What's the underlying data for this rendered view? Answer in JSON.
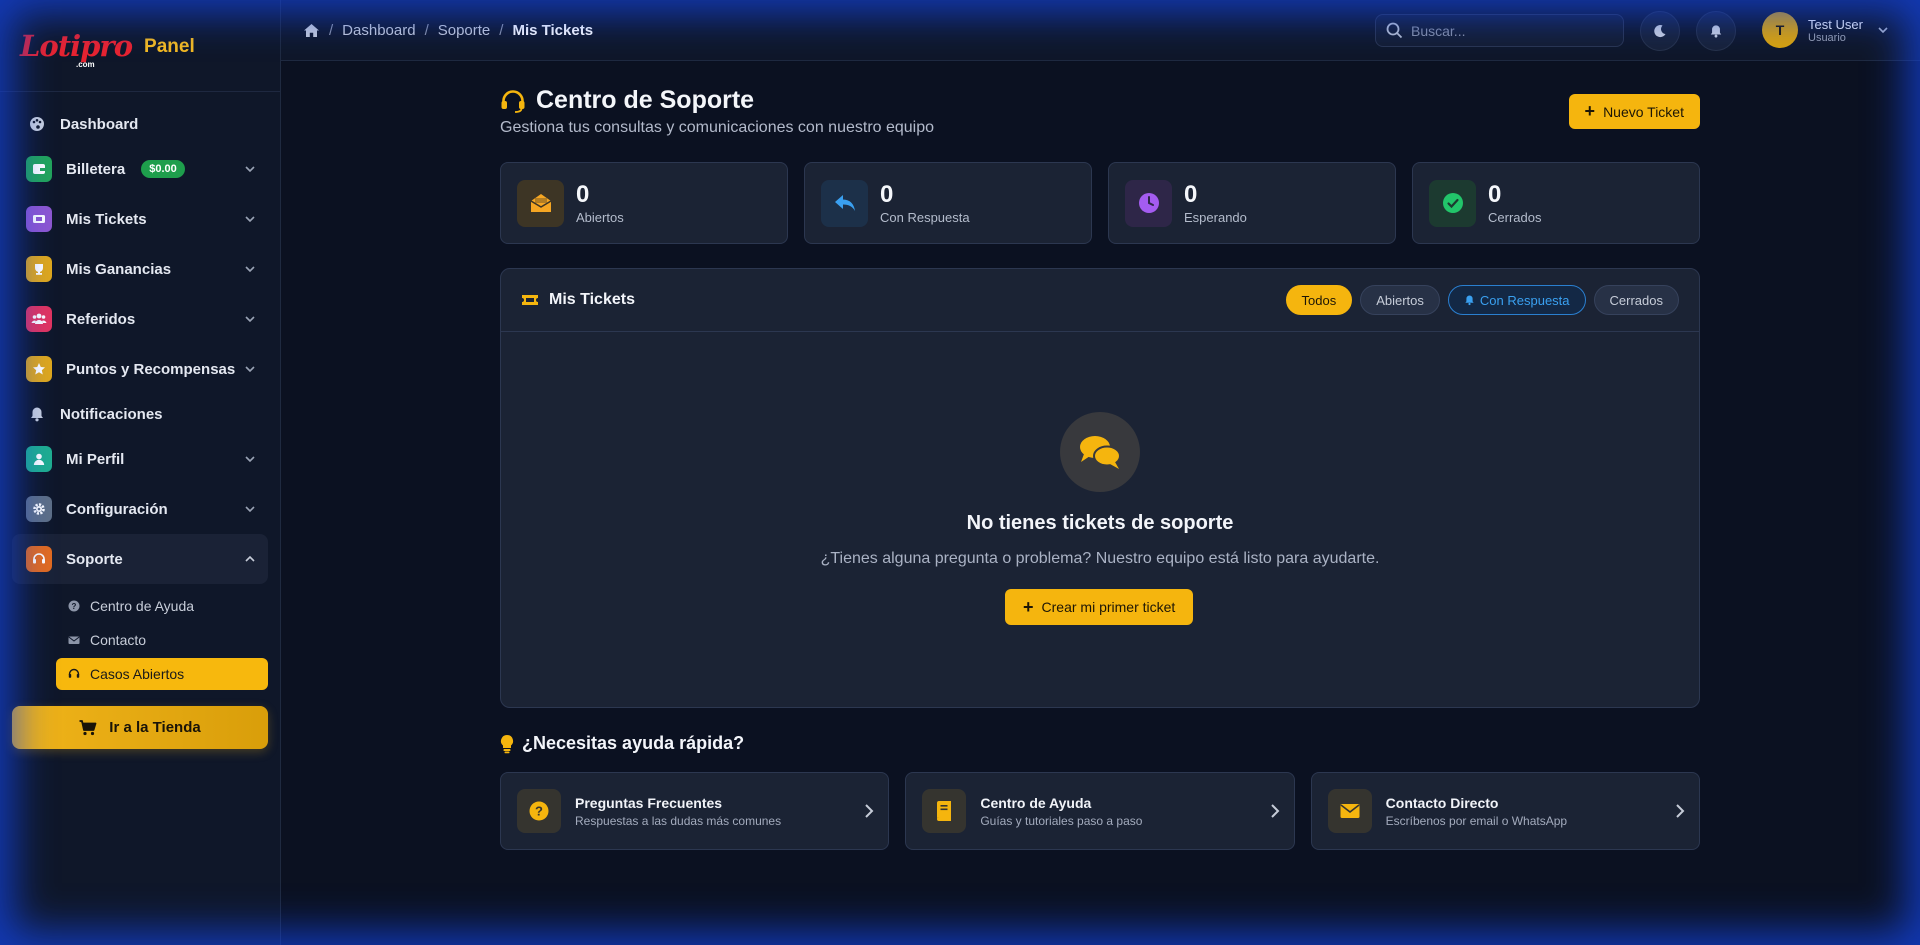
{
  "brand": {
    "logo_text": "Lotipro",
    "logo_suffix": ".com",
    "panel_label": "Panel"
  },
  "sidebar": {
    "items": [
      {
        "label": "Dashboard",
        "icon": "palette-icon"
      },
      {
        "label": "Billetera",
        "icon": "wallet-icon",
        "badge": "$0.00",
        "color": "#22a55a"
      },
      {
        "label": "Mis Tickets",
        "icon": "ticket-icon",
        "color": "#8e57d1"
      },
      {
        "label": "Mis Ganancias",
        "icon": "trophy-icon",
        "color": "#e0a81b"
      },
      {
        "label": "Referidos",
        "icon": "users-icon",
        "color": "#e3345f"
      },
      {
        "label": "Puntos y Recompensas",
        "icon": "star-icon",
        "color": "#e0a81b"
      },
      {
        "label": "Notificaciones",
        "icon": "bell-icon"
      },
      {
        "label": "Mi Perfil",
        "icon": "user-icon",
        "color": "#1fae8f"
      },
      {
        "label": "Configuración",
        "icon": "gear-icon",
        "color": "#5e6f86"
      },
      {
        "label": "Soporte",
        "icon": "headset-icon",
        "color": "#e46b1e"
      }
    ],
    "support_sub": [
      {
        "label": "Centro de Ayuda",
        "icon": "question-circle-icon"
      },
      {
        "label": "Contacto",
        "icon": "envelope-icon"
      },
      {
        "label": "Casos Abiertos",
        "icon": "headset-icon"
      }
    ],
    "shop_button": "Ir a la Tienda"
  },
  "topbar": {
    "breadcrumb": [
      "Dashboard",
      "Soporte",
      "Mis Tickets"
    ],
    "search_placeholder": "Buscar...",
    "user_name": "Test User",
    "user_role": "Usuario",
    "avatar_initial": "T"
  },
  "page": {
    "title": "Centro de Soporte",
    "subtitle": "Gestiona tus consultas y comunicaciones con nuestro equipo",
    "new_ticket": "Nuevo Ticket"
  },
  "stats": [
    {
      "value": "0",
      "label": "Abiertos",
      "icon": "envelope-open-icon",
      "color": "#f5a623"
    },
    {
      "value": "0",
      "label": "Con Respuesta",
      "icon": "reply-icon",
      "color": "#3aa0f0"
    },
    {
      "value": "0",
      "label": "Esperando",
      "icon": "clock-icon",
      "color": "#a45cf0"
    },
    {
      "value": "0",
      "label": "Cerrados",
      "icon": "check-circle-icon",
      "color": "#22c56a"
    }
  ],
  "tickets_panel": {
    "title": "Mis Tickets",
    "filters": [
      "Todos",
      "Abiertos",
      "Con Respuesta",
      "Cerrados"
    ],
    "active_filter": "Todos",
    "empty_title": "No tienes tickets de soporte",
    "empty_sub": "¿Tienes alguna pregunta o problema? Nuestro equipo está listo para ayudarte.",
    "create_first": "Crear mi primer ticket"
  },
  "quick_help": {
    "title": "¿Necesitas ayuda rápida?",
    "cards": [
      {
        "title": "Preguntas Frecuentes",
        "sub": "Respuestas a las dudas más comunes",
        "icon": "question-circle-icon"
      },
      {
        "title": "Centro de Ayuda",
        "sub": "Guías y tutoriales paso a paso",
        "icon": "book-icon"
      },
      {
        "title": "Contacto Directo",
        "sub": "Escríbenos por email o WhatsApp",
        "icon": "envelope-icon"
      }
    ]
  },
  "colors": {
    "accent": "#f5b50e",
    "background": "#0b1121",
    "card": "#1b2334",
    "glow": "#1446e6"
  }
}
